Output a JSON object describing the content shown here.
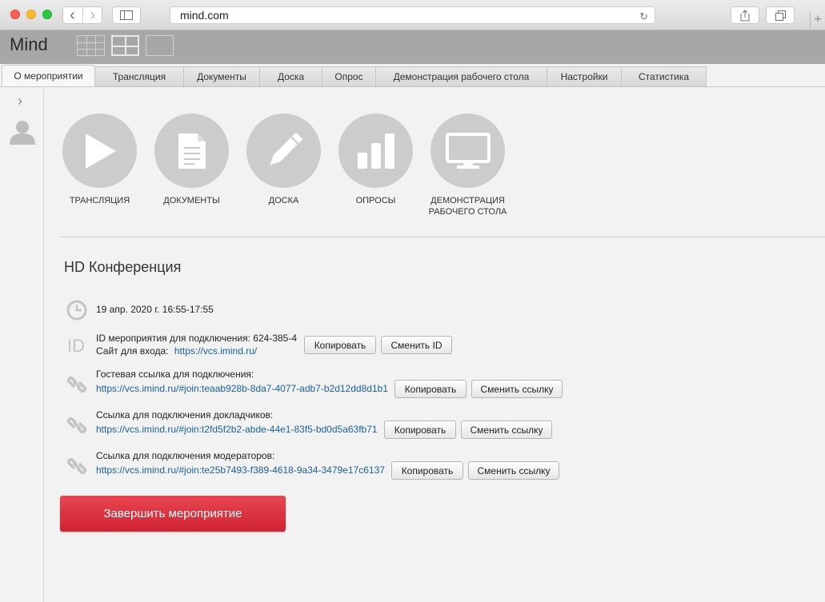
{
  "browser": {
    "url": "mind.com",
    "back_glyph": "‹",
    "forward_glyph": "›",
    "reload_glyph": "↻",
    "new_tab_glyph": "+"
  },
  "app": {
    "logo": "Mind"
  },
  "tabs": [
    {
      "label": "О мероприятии",
      "active": true
    },
    {
      "label": "Трансляция"
    },
    {
      "label": "Документы"
    },
    {
      "label": "Доска"
    },
    {
      "label": "Опрос"
    },
    {
      "label": "Демонстрация рабочего стола"
    },
    {
      "label": "Настройки"
    },
    {
      "label": "Статистика"
    }
  ],
  "rail": {
    "chevron_glyph": "›"
  },
  "features": [
    {
      "label": "ТРАНСЛЯЦИЯ",
      "icon": "play-icon"
    },
    {
      "label": "ДОКУМЕНТЫ",
      "icon": "document-icon"
    },
    {
      "label": "ДОСКА",
      "icon": "pencil-icon"
    },
    {
      "label": "ОПРОСЫ",
      "icon": "bar-chart-icon"
    },
    {
      "label_line1": "ДЕМОНСТРАЦИЯ",
      "label_line2": "РАБОЧЕГО СТОЛА",
      "icon": "monitor-icon"
    }
  ],
  "conference": {
    "title": "HD Конференция",
    "datetime": "19 апр. 2020 г. 16:55-17:55",
    "id_label": "ID мероприятия для подключения: 624-385-4",
    "site_label": "Сайт для входа:",
    "site_url": "https://vcs.imind.ru/",
    "guest_label": "Гостевая ссылка для подключения:",
    "guest_url": "https://vcs.imind.ru/#join:teaab928b-8da7-4077-adb7-b2d12dd8d1b1",
    "speakers_label": "Ссылка для подключения докладчиков:",
    "speakers_url": "https://vcs.imind.ru/#join:t2fd5f2b2-abde-44e1-83f5-bd0d5a63fb71",
    "moderators_label": "Ссылка для подключения модераторов:",
    "moderators_url": "https://vcs.imind.ru/#join:te25b7493-f389-4618-9a34-3479e17c6137"
  },
  "buttons": {
    "copy": "Копировать",
    "change_id": "Сменить ID",
    "change_link": "Сменить ссылку",
    "end_event": "Завершить мероприятие"
  },
  "colors": {
    "end_button": "#d92c3a",
    "link": "#1a5f9c",
    "feature_circle": "#cccccc"
  }
}
